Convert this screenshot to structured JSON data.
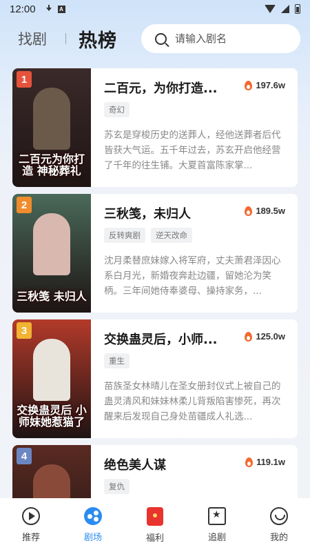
{
  "status": {
    "time": "12:00"
  },
  "header": {
    "tab_find": "找剧",
    "tab_hot": "热榜"
  },
  "search": {
    "placeholder": "请输入剧名"
  },
  "dramas": [
    {
      "rank": "1",
      "title": "二百元，为你打造...",
      "heat": "197.6w",
      "tags": [
        "奇幻"
      ],
      "desc": "苏玄是穿梭历史的送葬人，经他送葬者后代皆获大气运。五千年过去，苏玄开启他经营了千年的往生铺。大夏首富陈家掌...",
      "poster_title": "二百元为你打造 神秘葬礼",
      "rank_color": "#e5533d",
      "poster_bg": "#3b2a2a",
      "poster_fig": "#6b5a4a"
    },
    {
      "rank": "2",
      "title": "三秋笺，未归人",
      "heat": "189.5w",
      "tags": [
        "反转爽剧",
        "逆天改命"
      ],
      "desc": "沈月柔替庶妹嫁入将军府，丈夫萧君泽因心系白月光，新婚夜奔赴边疆，留她沦为笑柄。三年间她侍奉婆母、操持家务，...",
      "poster_title": "三秋笺 未归人",
      "rank_color": "#f08c2c",
      "poster_bg": "#4a6a5a",
      "poster_fig": "#d9b8b0"
    },
    {
      "rank": "3",
      "title": "交换蛊灵后，小师...",
      "heat": "125.0w",
      "tags": [
        "重生"
      ],
      "desc": "苗族圣女林晴儿在圣女册封仪式上被自己的蛊灵清风和妹妹林柔儿背叛陷害惨死，再次醒来后发现自己身处苗疆成人礼选...",
      "poster_title": "交换蛊灵后 小师妹她惹猫了",
      "rank_color": "#f2b233",
      "poster_bg": "#b33a2a",
      "poster_fig": "#e8e4dc"
    },
    {
      "rank": "4",
      "title": "绝色美人谋",
      "heat": "119.1w",
      "tags": [
        "复仇"
      ],
      "desc": "",
      "poster_title": "",
      "rank_color": "#6b86c2",
      "poster_bg": "#5a2a22",
      "poster_fig": "#8a4a3a"
    }
  ],
  "nav": [
    {
      "label": "推荐",
      "icon": "play-icon"
    },
    {
      "label": "剧场",
      "icon": "theater-icon",
      "active": true
    },
    {
      "label": "福利",
      "icon": "gift-icon"
    },
    {
      "label": "追剧",
      "icon": "favorites-icon"
    },
    {
      "label": "我的",
      "icon": "profile-icon"
    }
  ]
}
